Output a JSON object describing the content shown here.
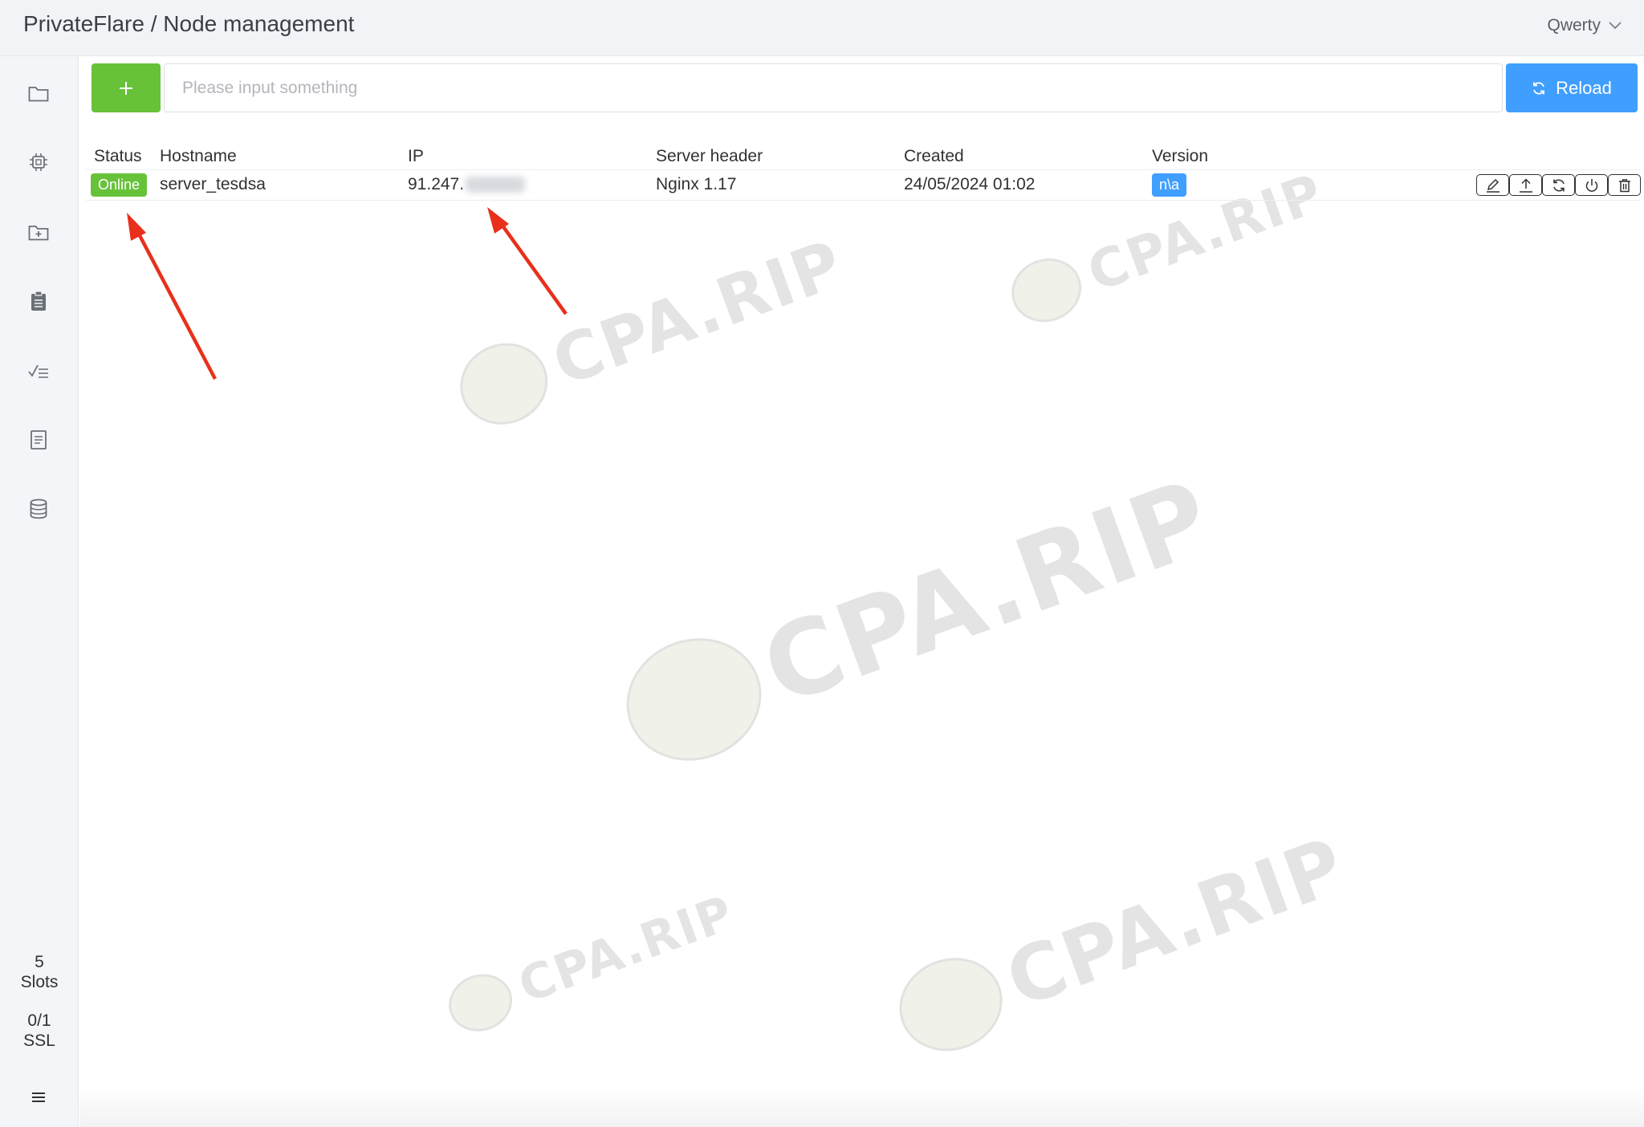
{
  "header": {
    "breadcrumb": "PrivateFlare / Node management",
    "user": "Qwerty"
  },
  "sidebar": {
    "icons": [
      "folder-icon",
      "chip-icon",
      "folder-add-icon",
      "clipboard-icon",
      "checklist-icon",
      "document-icon",
      "database-icon"
    ],
    "slots_count": "5",
    "slots_label": "Slots",
    "ssl_count": "0/1",
    "ssl_label": "SSL",
    "menu_icon": "menu-icon"
  },
  "toolbar": {
    "add_icon": "plus-icon",
    "search_placeholder": "Please input something",
    "reload_label": "Reload"
  },
  "table": {
    "headers": {
      "status": "Status",
      "hostname": "Hostname",
      "ip": "IP",
      "server_header": "Server header",
      "created": "Created",
      "version": "Version"
    },
    "rows": [
      {
        "status": "Online",
        "hostname": "server_tesdsa",
        "ip": "91.247.",
        "server_header": "Nginx 1.17",
        "created": "24/05/2024 01:02",
        "version": "n\\a",
        "actions": [
          "edit-icon",
          "upload-icon",
          "refresh-icon",
          "power-icon",
          "delete-icon"
        ]
      }
    ]
  },
  "watermark": {
    "text": "CPA.RIP"
  },
  "colors": {
    "success": "#67c23a",
    "primary": "#409eff",
    "annotation": "#e8301c",
    "topbar": "#f1f3f7",
    "sidebar": "#f4f5f8"
  }
}
